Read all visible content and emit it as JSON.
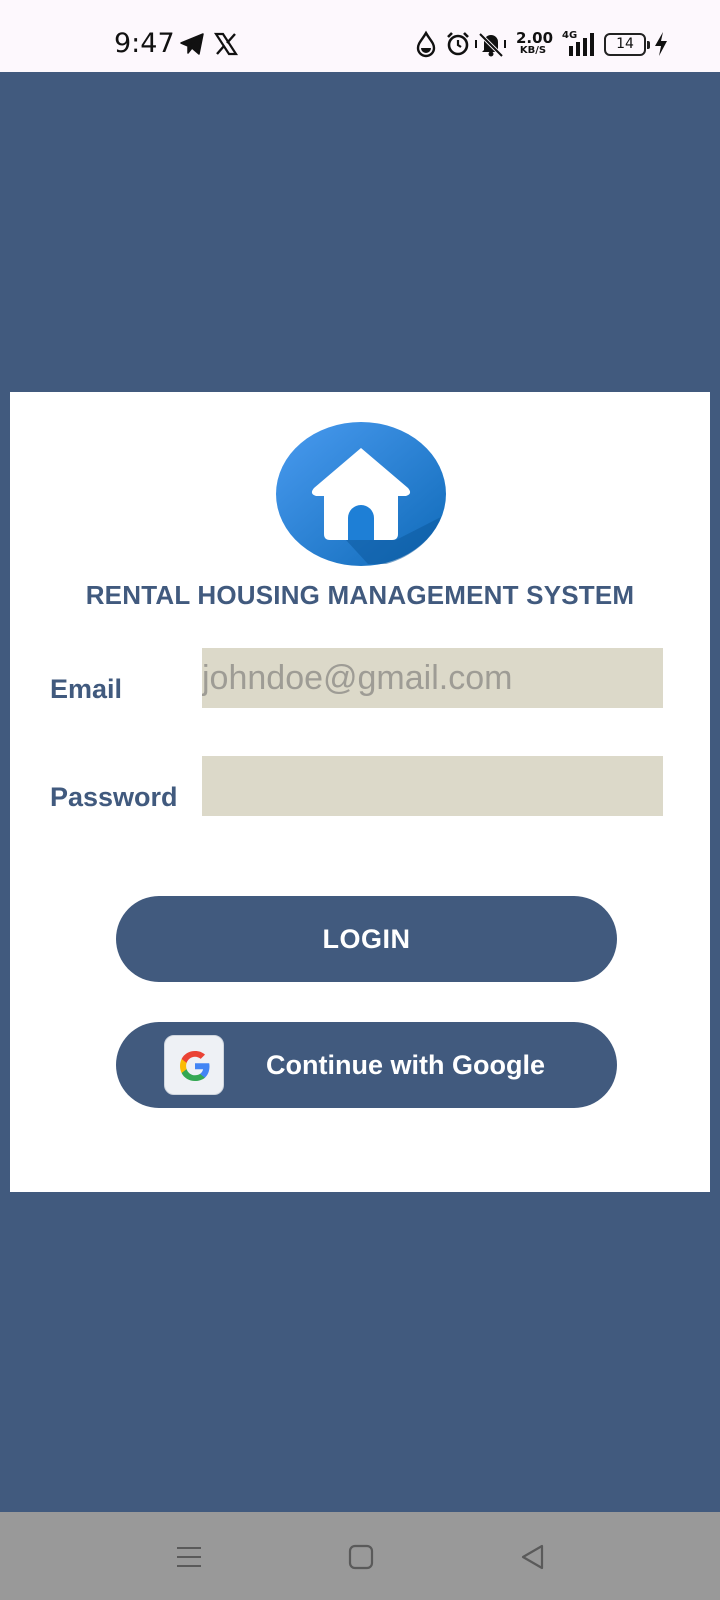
{
  "status_bar": {
    "time": "9:47",
    "net_speed_value": "2.00",
    "net_speed_unit": "KB/S",
    "network_type": "4G",
    "battery": "14",
    "icons": [
      "telegram-icon",
      "x-icon",
      "water-drop-icon",
      "alarm-icon",
      "vibrate-icon",
      "signal-icon",
      "battery-icon",
      "charging-icon"
    ]
  },
  "app": {
    "title": "RENTAL HOUSING MANAGEMENT SYSTEM",
    "logo_icon": "house-icon",
    "email_label": "Email",
    "email_placeholder": "johndoe@gmail.com",
    "email_value": "",
    "password_label": "Password",
    "password_value": "",
    "login_label": "LOGIN",
    "google_label": "Continue with Google",
    "google_icon": "google-icon"
  },
  "colors": {
    "background": "#415a7e",
    "accent": "#415a7e",
    "input_fill": "#dcd9c9",
    "logo_blue": "#1e7fd6"
  },
  "nav_bar": {
    "buttons": [
      "menu-icon",
      "home-icon",
      "back-icon"
    ]
  }
}
